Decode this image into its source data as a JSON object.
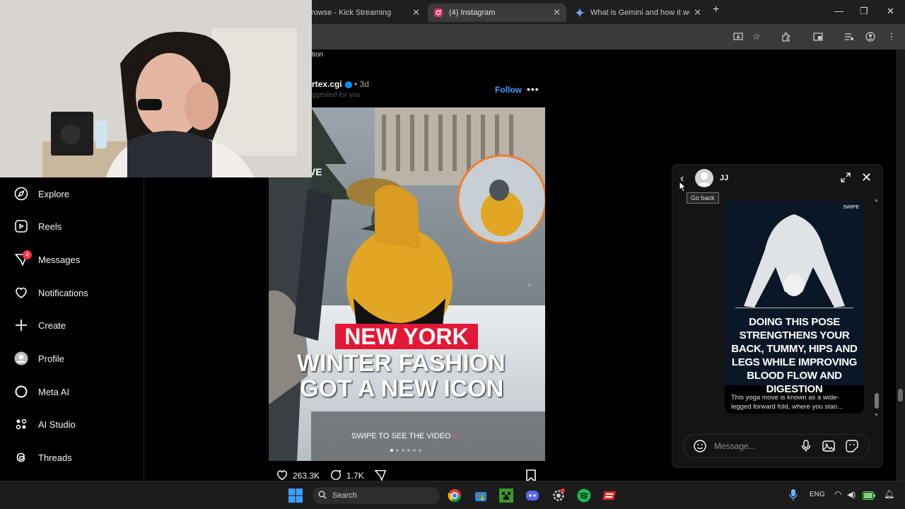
{
  "browser": {
    "tabs": [
      {
        "title": "rowse - Kick Streaming",
        "active": false
      },
      {
        "title": "(4) Instagram",
        "active": true
      },
      {
        "title": "What is Gemini and how it works",
        "active": false
      }
    ],
    "new_tab": "+"
  },
  "sidebar": {
    "items": [
      {
        "label": "Explore",
        "icon": "compass-icon"
      },
      {
        "label": "Reels",
        "icon": "reels-icon"
      },
      {
        "label": "Messages",
        "icon": "messages-icon",
        "badge": "4"
      },
      {
        "label": "Notifications",
        "icon": "heart-icon"
      },
      {
        "label": "Create",
        "icon": "plus-icon"
      },
      {
        "label": "Profile",
        "icon": "avatar-icon"
      },
      {
        "label": "Meta AI",
        "icon": "meta-ai-icon"
      },
      {
        "label": "AI Studio",
        "icon": "ai-studio-icon"
      },
      {
        "label": "Threads",
        "icon": "threads-icon"
      }
    ]
  },
  "post": {
    "page_text": "tion",
    "username": "rtex.cgi",
    "time": "3d",
    "suggested": "ggested for you",
    "follow": "Follow",
    "overlay_red": "NEW YORK",
    "overlay_line1": "WINTER FASHION",
    "overlay_line2": "GOT A NEW ICON",
    "swipe": "SWIPE TO SEE THE VIDEO",
    "partial_label": "VE",
    "likes": "263.3K",
    "comments": "1.7K"
  },
  "chat": {
    "name": "JJ",
    "tooltip": "Go back",
    "card_text": "DOING THIS POSE STRENGTHENS YOUR BACK, TUMMY, HIPS AND LEGS WHILE IMPROVING BLOOD FLOW AND DIGESTION",
    "card_caption": "This yoga move is known as a wide-legged forward fold, where you stan...",
    "card_watermark": "SWIPE",
    "placeholder": "Message..."
  },
  "taskbar": {
    "search": "Search",
    "lang": "ENG"
  },
  "colors": {
    "accent_blue": "#4a9dff",
    "badge_red": "#ff3040",
    "overlay_red": "#e31837"
  }
}
